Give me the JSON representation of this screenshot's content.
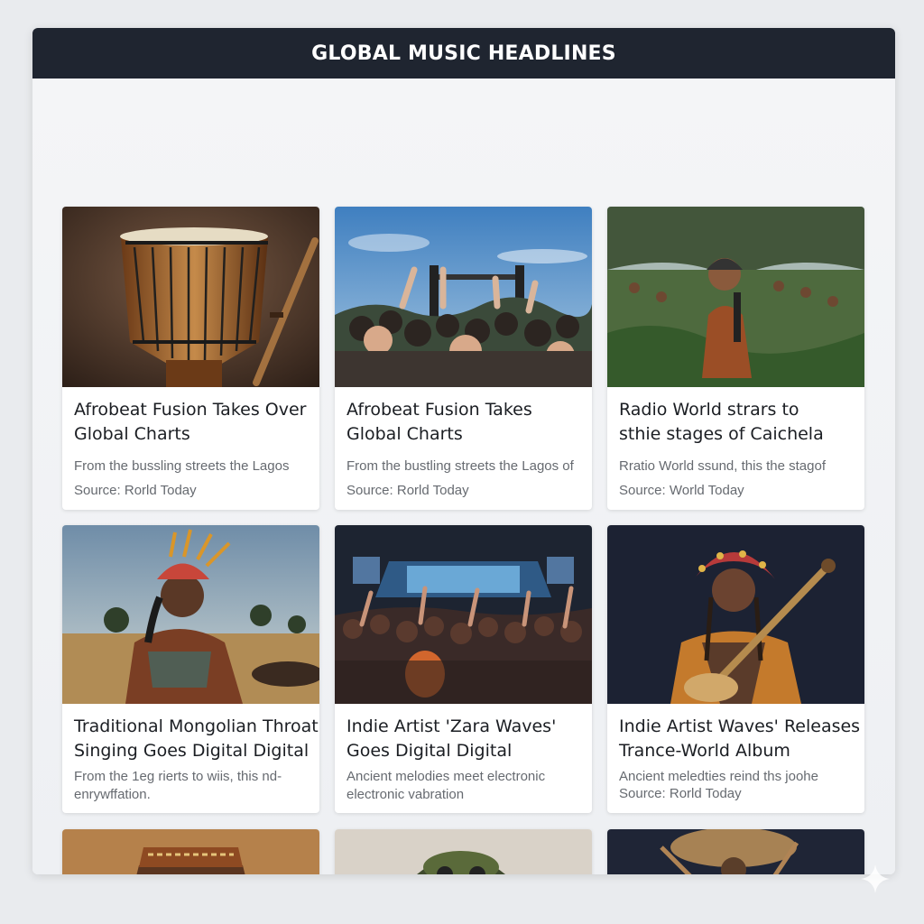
{
  "header": {
    "title": "GLOBAL MUSIC HEADLINES"
  },
  "cards": [
    {
      "image_icon": "djembe-drum-photo",
      "title_line1": "Afrobeat Fusion Takes Over",
      "title_line2": "Global Charts",
      "excerpt": "From the bussling streets the Lagos",
      "excerpt_line2": "",
      "source": "Source: Rorld Today"
    },
    {
      "image_icon": "festival-crowd-photo",
      "title_line1": "Afrobeat Fusion Takes",
      "title_line2": "Global Charts",
      "excerpt": "From the bustling streets the Lagos of",
      "excerpt_line2": "",
      "source": "Source: Rorld Today"
    },
    {
      "image_icon": "outdoor-performer-photo",
      "title_line1": "Radio World strars to",
      "title_line2": "sthie stages of Caichela",
      "excerpt": "Rratio World ssund, this the stagof",
      "excerpt_line2": "",
      "source": "Source: World Today"
    },
    {
      "image_icon": "headdress-musician-photo",
      "title_line1": "Traditional Mongolian Throat",
      "title_line2": "Singing Goes Digital Digital",
      "excerpt": "From the 1eg rierts to wiis, this  nd-",
      "excerpt_line2": "enrywffation.",
      "source": ""
    },
    {
      "image_icon": "concert-stage-photo",
      "title_line1": "Indie Artist 'Zara Waves'",
      "title_line2": "Goes Digital Digital",
      "excerpt": "Ancient melodies meet electronic",
      "excerpt_line2": "electronic vabration",
      "source": ""
    },
    {
      "image_icon": "guitar-player-photo",
      "title_line1": "Indie Artist Waves' Releases",
      "title_line2": "Trance-World Album",
      "excerpt": "Ancient meledties reind ths joohe",
      "excerpt_line2": "",
      "source": "Source: Rorld Today"
    }
  ],
  "partial_cards": [
    "drum-photo",
    "headdress-photo",
    "instrument-photo"
  ],
  "colors": {
    "header_bg": "#1f2530",
    "card_bg": "#ffffff",
    "text_dark": "#1b1e23",
    "text_muted": "#666a70"
  }
}
